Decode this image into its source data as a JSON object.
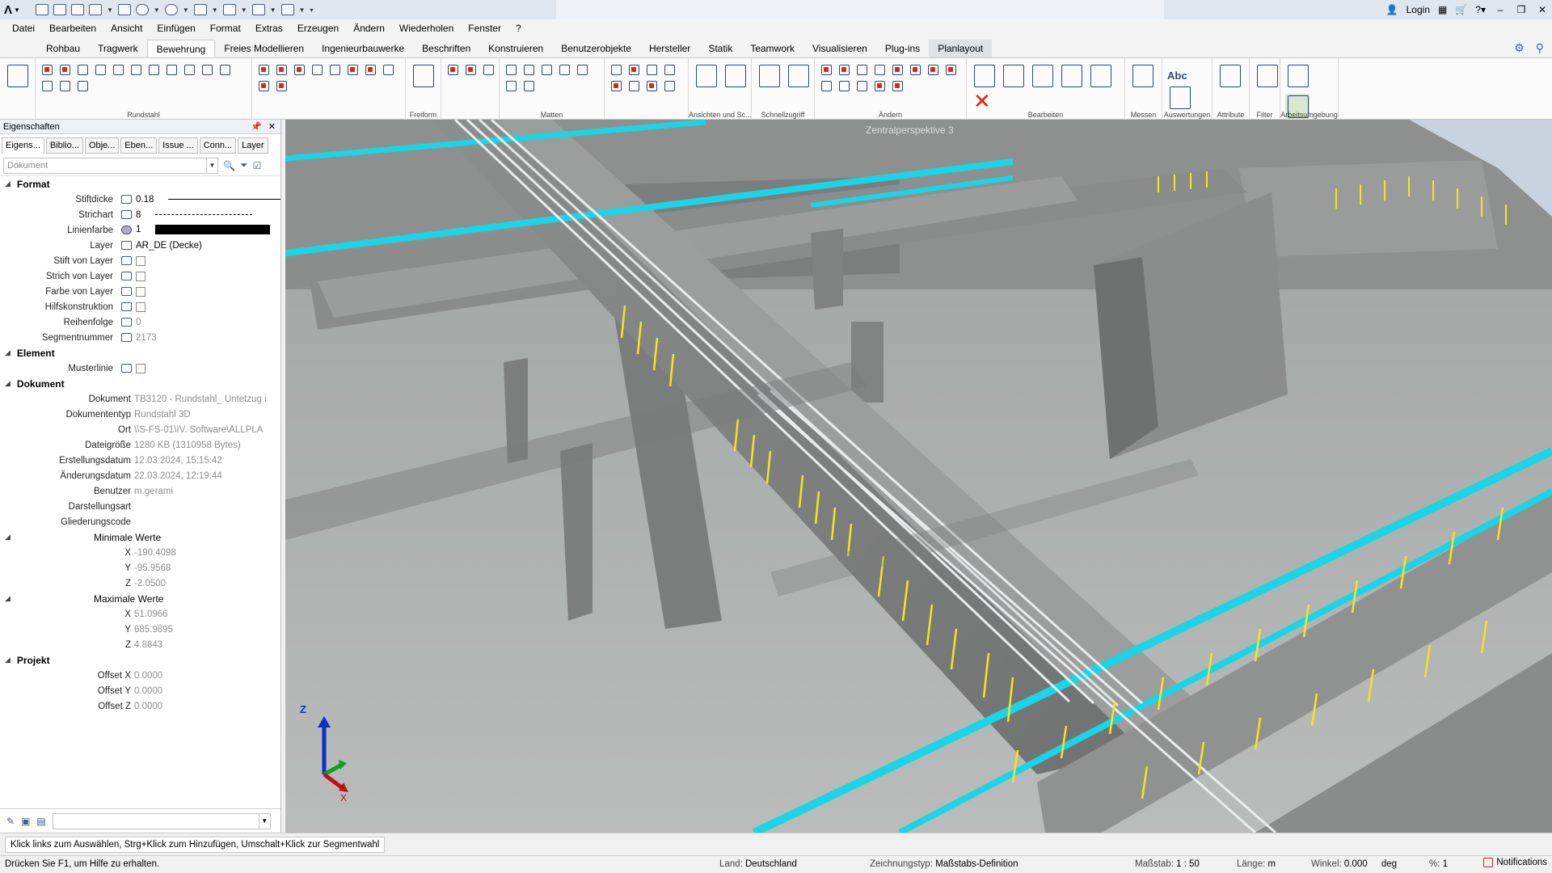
{
  "app": {
    "logo_glyph": "Λ"
  },
  "titlebar": {
    "login_label": "Login"
  },
  "menu": [
    "Datei",
    "Bearbeiten",
    "Ansicht",
    "Einfügen",
    "Format",
    "Extras",
    "Erzeugen",
    "Ändern",
    "Wiederholen",
    "Fenster",
    "?"
  ],
  "ribbon_tabs": [
    "Rohbau",
    "Tragwerk",
    "Bewehrung",
    "Freies Modellieren",
    "Ingenieurbauwerke",
    "Beschriften",
    "Konstruieren",
    "Benutzerobjekte",
    "Hersteller",
    "Statik",
    "Teamwork",
    "Visualisieren",
    "Plug-ins",
    "Planlayout"
  ],
  "ribbon_groups": {
    "rundstahl": "Rundstahl",
    "freiform": "Freiform",
    "matten": "Matten",
    "ansichten": "Ansichten und Sc...",
    "schnellzugriff": "Schnellzugriff",
    "aendern": "Ändern",
    "bearbeiten": "Bearbeiten",
    "messen": "Messen",
    "auswertungen": "Auswertungen",
    "attribute": "Attribute",
    "filter": "Filter",
    "arbeitsumgebung": "Arbeitsumgebung"
  },
  "ribbon_text_icon": "Abc",
  "properties": {
    "title": "Eigenschaften",
    "tabs": [
      "Eigens...",
      "Biblio...",
      "Obje...",
      "Eben...",
      "Issue ...",
      "Conn...",
      "Layer"
    ],
    "search_placeholder": "Dokument",
    "format": {
      "header": "Format",
      "stiftdicke_label": "Stiftdicke",
      "stiftdicke_value": "0.18",
      "strichart_label": "Strichart",
      "strichart_value": "8",
      "linienfarbe_label": "Linienfarbe",
      "linienfarbe_value": "1",
      "layer_label": "Layer",
      "layer_value": "AR_DE (Decke)",
      "stift_von_layer": "Stift von Layer",
      "strich_von_layer": "Strich von Layer",
      "farbe_von_layer": "Farbe von Layer",
      "hilfskonstruktion": "Hilfskonstruktion",
      "reihenfolge_label": "Reihenfolge",
      "reihenfolge_value": "0",
      "segmentnummer_label": "Segmentnummer",
      "segmentnummer_value": "2173"
    },
    "element": {
      "header": "Element",
      "musterlinie": "Musterlinie"
    },
    "dokument": {
      "header": "Dokument",
      "dokument_label": "Dokument",
      "dokument_value": "TB3120 - Rundstahl_ Untetzug i",
      "typ_label": "Dokumententyp",
      "typ_value": "Rundstahl 3D",
      "ort_label": "Ort",
      "ort_value": "\\\\S-FS-01\\IV. Software\\ALLPLA",
      "groesse_label": "Dateigröße",
      "groesse_value": "1280 KB (1310958 Bytes)",
      "erstellt_label": "Erstellungsdatum",
      "erstellt_value": "12.03.2024, 15:15:42",
      "geaendert_label": "Änderungsdatum",
      "geaendert_value": "22.03.2024, 12:19:44",
      "benutzer_label": "Benutzer",
      "benutzer_value": "m.gerami",
      "darstellungsart_label": "Darstellungsart",
      "gliederungscode_label": "Gliederungscode",
      "min_label": "Minimale Werte",
      "min_x": "-190.4098",
      "min_y": "-95.9568",
      "min_z": "-2.0500",
      "max_label": "Maximale Werte",
      "max_x": "51.0966",
      "max_y": "685.9895",
      "max_z": "4.8843",
      "x": "X",
      "y": "Y",
      "z": "Z"
    },
    "projekt": {
      "header": "Projekt",
      "offx_label": "Offset X",
      "offx_value": "0.0000",
      "offy_label": "Offset Y",
      "offy_value": "0.0000",
      "offz_label": "Offset Z",
      "offz_value": "0.0000"
    }
  },
  "viewport": {
    "label": "Zentralperspektive 3",
    "axis_z": "Z",
    "axis_x": "X"
  },
  "hint": "Klick links zum Auswählen, Strg+Klick zum Hinzufügen, Umschalt+Klick zur Segmentwahl",
  "status": {
    "help": "Drücken Sie F1, um Hilfe zu erhalten.",
    "land_label": "Land:",
    "land_value": "Deutschland",
    "zeichnungstyp_label": "Zeichnungstyp:",
    "zeichnungstyp_value": "Maßstabs-Definition",
    "massstab_label": "Maßstab:",
    "massstab_value": "1 : 50",
    "laenge_label": "Länge:",
    "laenge_value": "m",
    "winkel_label": "Winkel:",
    "winkel_value": "0.000",
    "winkel_unit": "deg",
    "prozent_label": "%:",
    "prozent_value": "1",
    "notifications": "Notifications"
  },
  "colors": {
    "rebar_cyan": "#19d5e6",
    "stirrup_yellow": "#f4e61c",
    "concrete": "#8f9190",
    "floor": "#aeb2b0",
    "sky": "#c9d3df"
  }
}
